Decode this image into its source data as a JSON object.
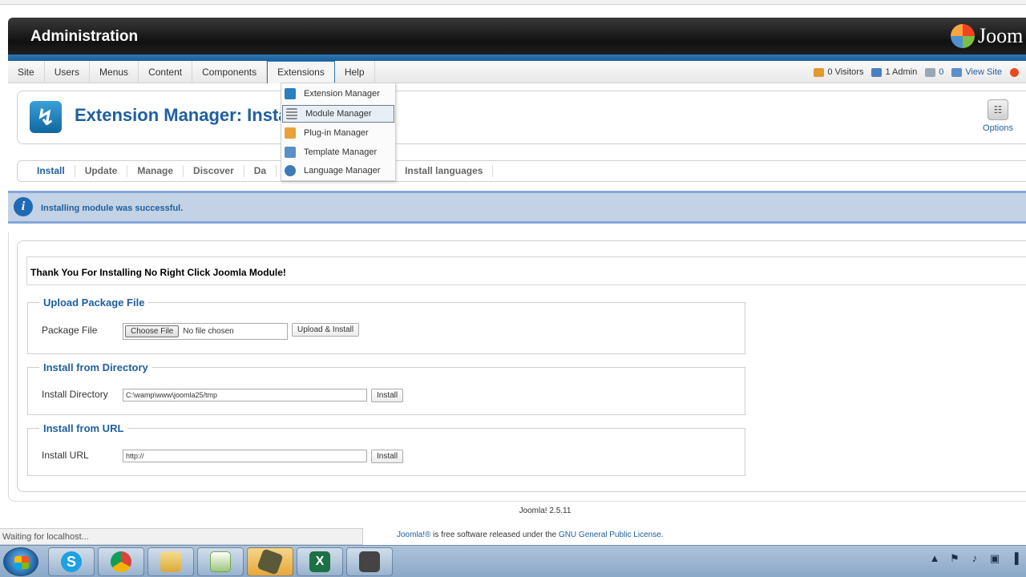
{
  "header": {
    "title": "Administration",
    "logo_text": "Joom"
  },
  "menu": [
    {
      "label": "Site"
    },
    {
      "label": "Users"
    },
    {
      "label": "Menus"
    },
    {
      "label": "Content"
    },
    {
      "label": "Components"
    },
    {
      "label": "Extensions"
    },
    {
      "label": "Help"
    }
  ],
  "status": {
    "visitors": "0 Visitors",
    "admins": "1 Admin",
    "messages": "0",
    "view_site": "View Site"
  },
  "dropdown": [
    {
      "label": "Extension Manager",
      "icon": "extension-manager-icon",
      "color": "#2a7fc0"
    },
    {
      "label": "Module Manager",
      "icon": "module-manager-icon",
      "color": "#8a8a8a"
    },
    {
      "label": "Plug-in Manager",
      "icon": "plugin-manager-icon",
      "color": "#e8a23a"
    },
    {
      "label": "Template Manager",
      "icon": "template-manager-icon",
      "color": "#5b8fc8"
    },
    {
      "label": "Language Manager",
      "icon": "language-manager-icon",
      "color": "#3f7ab8"
    }
  ],
  "toolbar": {
    "title": "Extension Manager: Insta",
    "options_label": "Options"
  },
  "tabs": [
    {
      "label": "Install"
    },
    {
      "label": "Update"
    },
    {
      "label": "Manage"
    },
    {
      "label": "Discover"
    },
    {
      "label": "Da"
    },
    {
      "label": "Install languages"
    }
  ],
  "message": {
    "text": "Installing module was successful."
  },
  "thanks": "Thank You For Installing No Right Click Joomla Module!",
  "upload": {
    "legend": "Upload Package File",
    "label": "Package File",
    "choose": "Choose File",
    "no_file": "No file chosen",
    "button": "Upload & Install"
  },
  "directory": {
    "legend": "Install from Directory",
    "label": "Install Directory",
    "value": "C:\\wamp\\www\\joomla25/tmp",
    "button": "Install"
  },
  "url": {
    "legend": "Install from URL",
    "label": "Install URL",
    "value": "http://",
    "button": "Install"
  },
  "footer": {
    "version": "Joomla! 2.5.11",
    "joomla_link": "Joomla!®",
    "license_text": " is free software released under the ",
    "license_link": "GNU General Public License",
    "license_end": "."
  },
  "browser_status": "Waiting for localhost...",
  "taskbar": [
    {
      "name": "skype-icon",
      "color": "#1da1e2"
    },
    {
      "name": "chrome-icon",
      "color": "#d94a38"
    },
    {
      "name": "file-explorer-icon",
      "color": "#e8c15a"
    },
    {
      "name": "notepad-plus-plus-icon",
      "color": "#6aa84f"
    },
    {
      "name": "screen-capture-app-icon",
      "color": "#5a5a3a"
    },
    {
      "name": "excel-icon",
      "color": "#1d7044"
    },
    {
      "name": "record-app-icon",
      "color": "#444444"
    }
  ]
}
